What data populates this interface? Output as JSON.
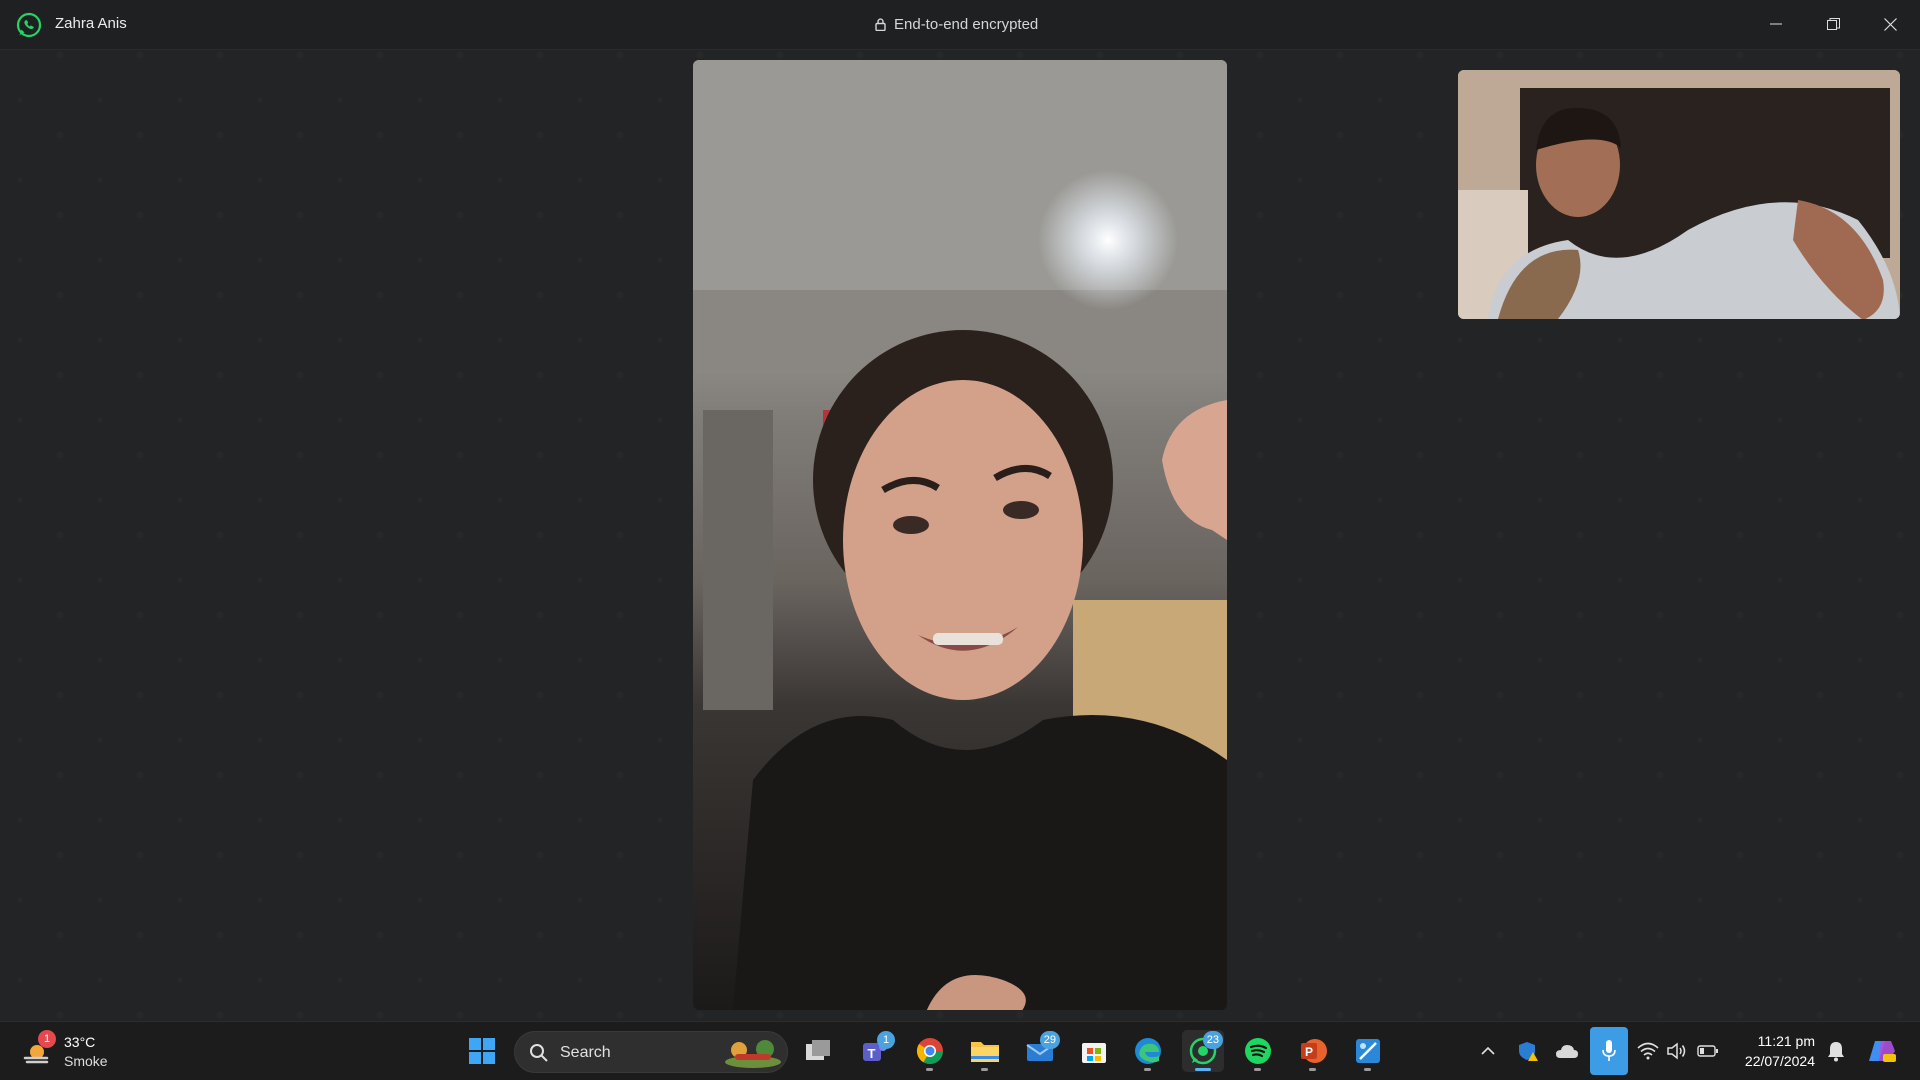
{
  "window": {
    "contact_name": "Zahra Anis",
    "encryption_label": "End-to-end encrypted"
  },
  "colors": {
    "whatsapp_green": "#25D366",
    "background": "#232425",
    "titlebar": "#1f2021",
    "taskbar": "#1c1c1c",
    "accent_blue": "#3c9de6"
  },
  "videos": {
    "main": {
      "icon": "remote-video-feed"
    },
    "self": {
      "icon": "self-video-preview"
    }
  },
  "taskbar": {
    "weather": {
      "badge": "1",
      "temperature": "33°C",
      "condition": "Smoke"
    },
    "search_label": "Search",
    "apps": [
      {
        "icon": "start-icon",
        "badge": ""
      },
      {
        "icon": "task-view-icon",
        "badge": ""
      },
      {
        "icon": "teams-icon",
        "badge": "1"
      },
      {
        "icon": "chrome-icon",
        "badge": ""
      },
      {
        "icon": "file-explorer-icon",
        "badge": ""
      },
      {
        "icon": "mail-icon",
        "badge": "29"
      },
      {
        "icon": "store-icon",
        "badge": ""
      },
      {
        "icon": "edge-icon",
        "badge": ""
      },
      {
        "icon": "whatsapp-icon",
        "badge": "23"
      },
      {
        "icon": "spotify-icon",
        "badge": ""
      },
      {
        "icon": "powerpoint-icon",
        "badge": ""
      },
      {
        "icon": "snipping-tool-icon",
        "badge": ""
      }
    ],
    "clock": {
      "time": "11:21 pm",
      "date": "22/07/2024"
    }
  }
}
